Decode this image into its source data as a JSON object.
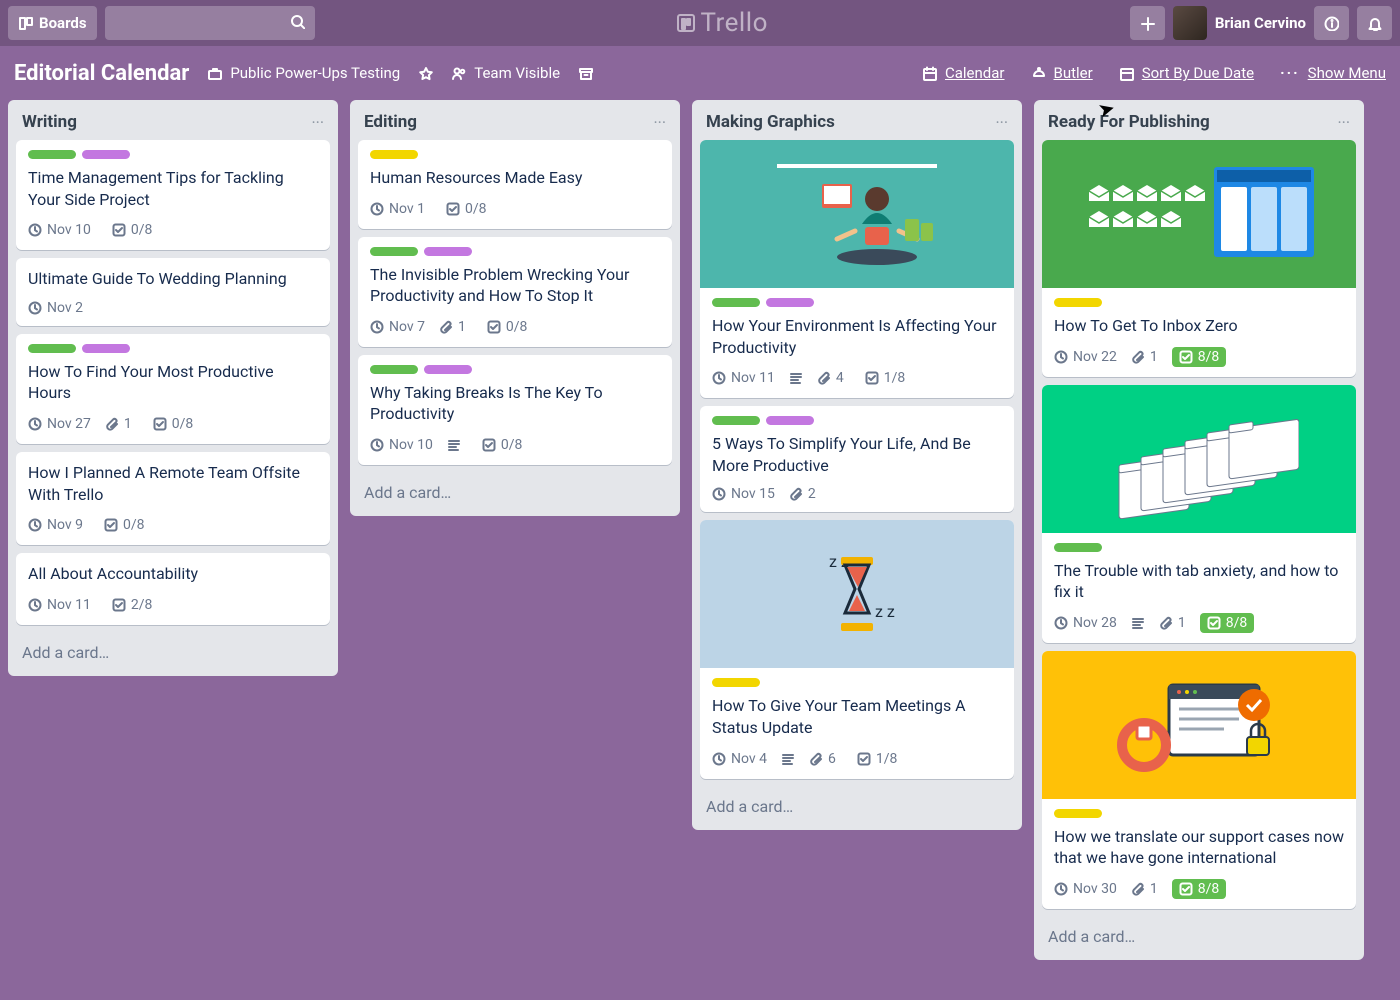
{
  "nav": {
    "boards_label": "Boards",
    "logo_text": "Trello",
    "user_name": "Brian Cervino"
  },
  "board_header": {
    "title": "Editorial Calendar",
    "org": "Public Power-Ups Testing",
    "visibility": "Team Visible",
    "calendar": "Calendar",
    "butler": "Butler",
    "sort": "Sort By Due Date",
    "show_menu": "Show Menu"
  },
  "add_card_label": "Add a card…",
  "lists": [
    {
      "title": "Writing",
      "cards": [
        {
          "labels": [
            "lg",
            "lp"
          ],
          "title": "Time Management Tips for Tackling Your Side Project",
          "date": "Nov 10",
          "check": "0/8"
        },
        {
          "labels": [],
          "title": "Ultimate Guide To Wedding Planning",
          "date": "Nov 2"
        },
        {
          "labels": [
            "lg",
            "lp"
          ],
          "title": "How To Find Your Most Productive Hours",
          "date": "Nov 27",
          "attach": "1",
          "check": "0/8"
        },
        {
          "labels": [],
          "title": "How I Planned A Remote Team Offsite With Trello",
          "date": "Nov 9",
          "check": "0/8"
        },
        {
          "labels": [],
          "title": "All About Accountability",
          "date": "Nov 11",
          "check": "2/8"
        }
      ]
    },
    {
      "title": "Editing",
      "cards": [
        {
          "labels": [
            "ly"
          ],
          "title": "Human Resources Made Easy",
          "date": "Nov 1",
          "check": "0/8"
        },
        {
          "labels": [
            "lg",
            "lp"
          ],
          "title": "The Invisible Problem Wrecking Your Productivity and How To Stop It",
          "date": "Nov 7",
          "attach": "1",
          "check": "0/8"
        },
        {
          "labels": [
            "lg",
            "lp"
          ],
          "title": "Why Taking Breaks Is The Key To Productivity",
          "date": "Nov 10",
          "desc": true,
          "check": "0/8"
        }
      ]
    },
    {
      "title": "Making Graphics",
      "cards": [
        {
          "cover": "#4db6ac",
          "cover_kind": "meditate",
          "labels": [
            "lg",
            "lp"
          ],
          "title": "How Your Environment Is Affecting Your Productivity",
          "date": "Nov 11",
          "desc": true,
          "attach": "4",
          "check": "1/8"
        },
        {
          "labels": [
            "lg",
            "lp"
          ],
          "title": "5 Ways To Simplify Your Life, And Be More Productive",
          "date": "Nov 15",
          "attach": "2"
        },
        {
          "cover": "#bcd4e6",
          "cover_kind": "hourglass",
          "labels": [
            "ly"
          ],
          "title": "How To Give Your Team Meetings A Status Update",
          "date": "Nov 4",
          "desc": true,
          "attach": "6",
          "check": "1/8"
        }
      ]
    },
    {
      "title": "Ready For Publishing",
      "cards": [
        {
          "cover": "#49a94d",
          "cover_kind": "inbox",
          "labels": [
            "ly"
          ],
          "title": "How To Get To Inbox Zero",
          "date": "Nov 22",
          "attach": "1",
          "check": "8/8",
          "check_done": true
        },
        {
          "cover": "#00d084",
          "cover_kind": "tabs",
          "labels": [
            "lg"
          ],
          "title": "The Trouble with tab anxiety, and how to fix it",
          "date": "Nov 28",
          "desc": true,
          "attach": "1",
          "check": "8/8",
          "check_done": true
        },
        {
          "cover": "#ffc107",
          "cover_kind": "secure",
          "labels": [
            "ly"
          ],
          "title": "How we translate our support cases now that we have gone international",
          "date": "Nov 30",
          "attach": "1",
          "check": "8/8",
          "check_done": true
        }
      ]
    }
  ]
}
